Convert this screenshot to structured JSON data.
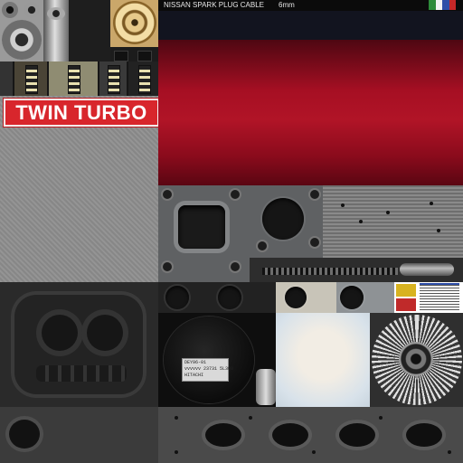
{
  "badge": {
    "text": "TWIN TURBO"
  },
  "header": {
    "title": "NISSAN SPARK PLUG CABLE",
    "size": "6mm"
  },
  "sensor_label": {
    "lines": [
      "DEY96-01",
      "vvvvvv 23731 5L300",
      "HITACHI"
    ]
  },
  "colors": {
    "badge_red": "#d8262c",
    "panel_red": "#a60f23",
    "navy": "#12141f",
    "flag": [
      "#2e8b3a",
      "#f2f2f2",
      "#2f4fa8",
      "#c62828"
    ]
  }
}
